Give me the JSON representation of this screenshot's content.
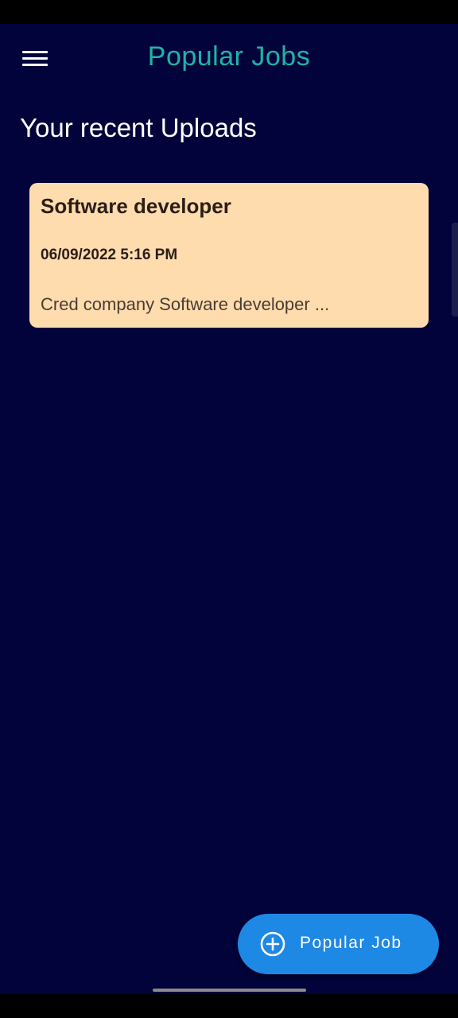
{
  "app_bar": {
    "title": "Popular Jobs",
    "menu_icon": "hamburger-menu-icon",
    "title_color": "#1fb3a5"
  },
  "section": {
    "title": "Your recent Uploads"
  },
  "uploads": [
    {
      "title": "Software developer",
      "date": "06/09/2022 5:16 PM",
      "description": "Cred company Software developer ..."
    }
  ],
  "fab": {
    "label": "Popular Job",
    "icon": "add-circle-icon",
    "color": "#1e88e5"
  },
  "colors": {
    "background": "#03033b",
    "card": "#ffdcae"
  }
}
